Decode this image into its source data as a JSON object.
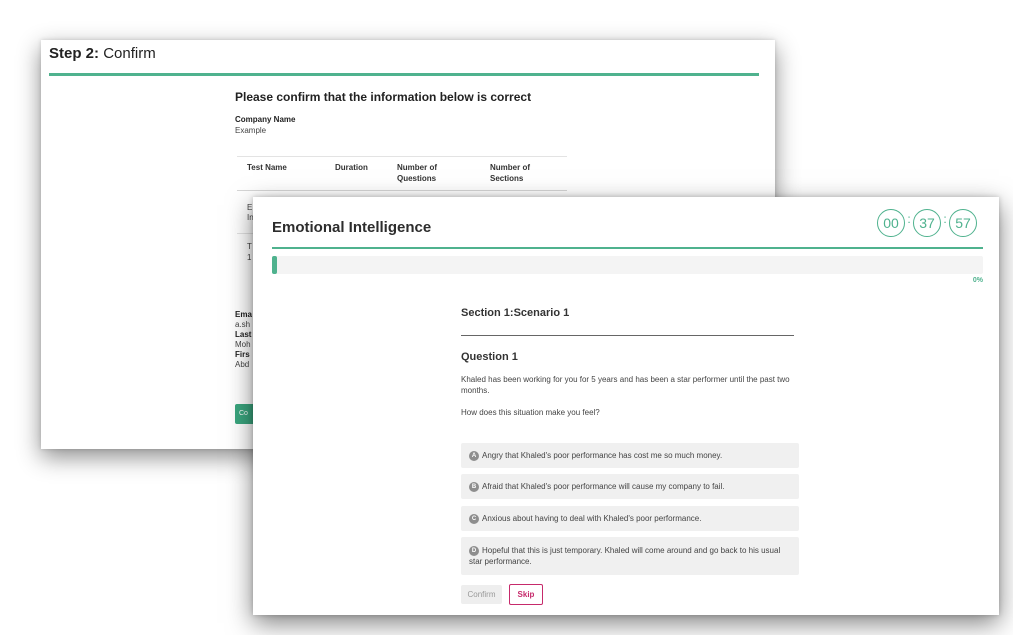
{
  "confirm_page": {
    "step_label": "Step 2:",
    "step_title": "Confirm",
    "heading": "Please confirm that the information below is correct",
    "company_label": "Company Name",
    "company_value": "Example",
    "table_headers": [
      "Test Name",
      "Duration",
      "Number of Questions",
      "Number of Sections"
    ],
    "row_fragments": [
      "E",
      "In",
      "T",
      "1"
    ],
    "field_fragments": [
      "Ema",
      "a.sh",
      "Last",
      "Moh",
      "Firs",
      "Abd"
    ],
    "button_fragment": "Co"
  },
  "test": {
    "title": "Emotional Intelligence",
    "timer": {
      "hours": "00",
      "minutes": "37",
      "seconds": "57",
      "separator": ":"
    },
    "progress": {
      "fraction": 0.0,
      "label": "0%"
    },
    "section_title": "Section 1:Scenario 1",
    "question_title": "Question 1",
    "question_text": "Khaled has been working for you for 5 years and has been a star performer until the past two months.",
    "question_prompt": "How does this situation make you feel?",
    "answers": [
      {
        "letter": "A",
        "text": "Angry that Khaled's poor performance has cost me so much money."
      },
      {
        "letter": "B",
        "text": "Afraid that Khaled's poor performance will cause my company to fail."
      },
      {
        "letter": "C",
        "text": "Anxious about having to deal with Khaled's poor performance."
      },
      {
        "letter": "D",
        "text": "Hopeful that this is just temporary. Khaled will come around and go back to his usual star performance."
      }
    ],
    "confirm_label": "Confirm",
    "skip_label": "Skip"
  },
  "colors": {
    "accent": "#4fb28e",
    "skip": "#c62a6b"
  }
}
